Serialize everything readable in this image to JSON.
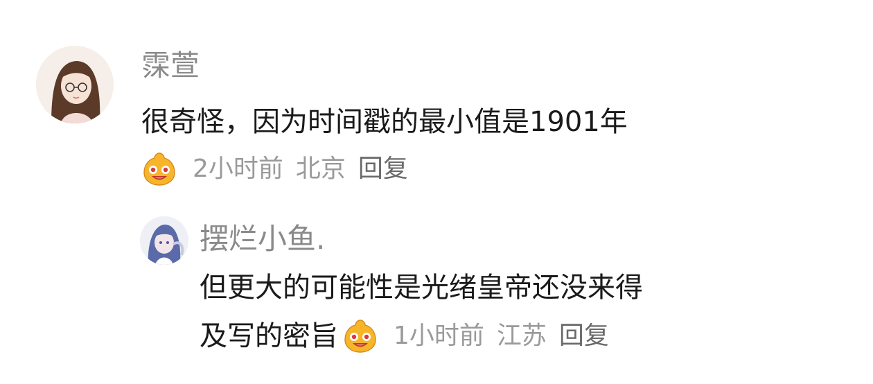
{
  "comments": [
    {
      "username": "霂萱",
      "text": "很奇怪，因为时间戳的最小值是1901年",
      "time": "2小时前",
      "location": "北京",
      "reply_label": "回复",
      "emoji_icon": "smiling-blob-emoji"
    },
    {
      "username": "摆烂小鱼.",
      "text_line1": "但更大的可能性是光绪皇帝还没来得",
      "text_line2": "及写的密旨",
      "time": "1小时前",
      "location": "江苏",
      "reply_label": "回复",
      "emoji_icon": "smiling-blob-emoji"
    }
  ],
  "colors": {
    "username": "#8a8a8a",
    "text": "#1a1a1a",
    "meta": "#9a9a9a",
    "reply": "#6a6a6a",
    "emoji": "#f7b52a"
  }
}
